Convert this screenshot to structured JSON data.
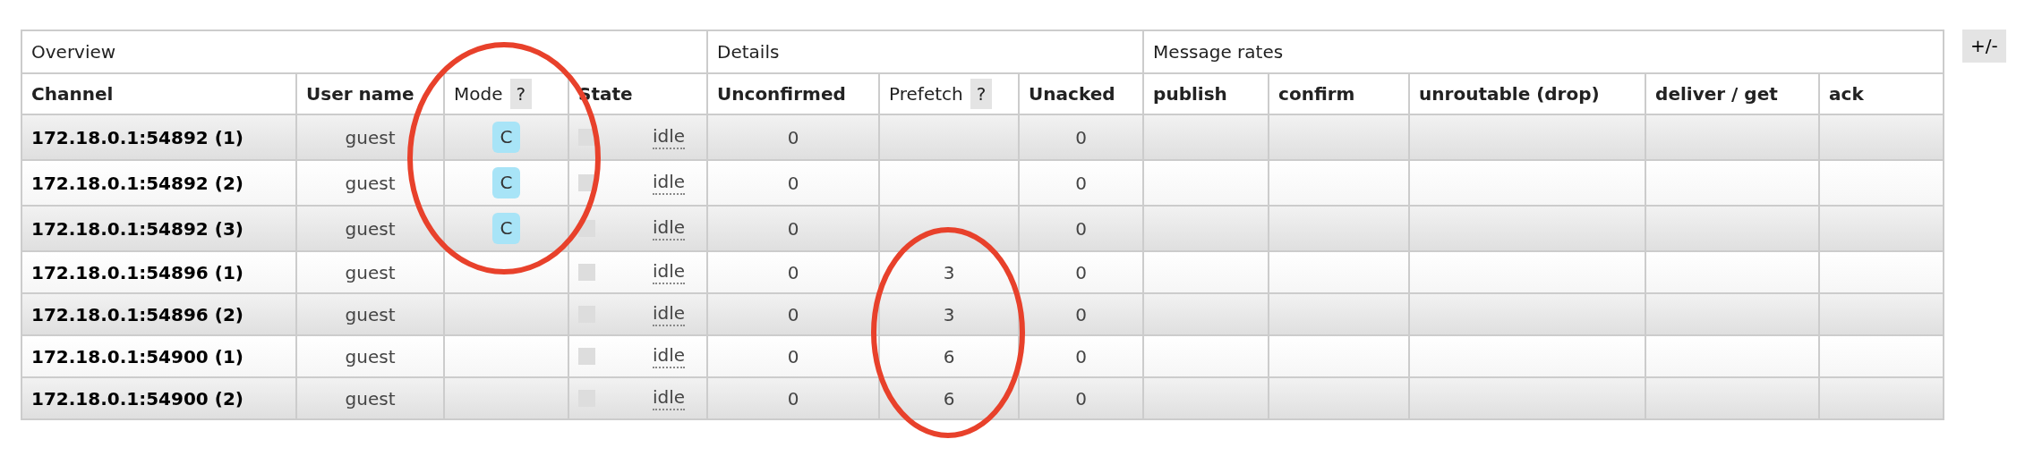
{
  "column_groups": [
    {
      "label": "Overview",
      "columns": [
        {
          "label": "Channel"
        },
        {
          "label": "User name"
        },
        {
          "label": "Mode",
          "help": "?"
        },
        {
          "label": "State"
        }
      ]
    },
    {
      "label": "Details",
      "columns": [
        {
          "label": "Unconfirmed"
        },
        {
          "label": "Prefetch",
          "help": "?"
        },
        {
          "label": "Unacked"
        }
      ]
    },
    {
      "label": "Message rates",
      "columns": [
        {
          "label": "publish"
        },
        {
          "label": "confirm"
        },
        {
          "label": "unroutable (drop)"
        },
        {
          "label": "deliver / get"
        },
        {
          "label": "ack"
        }
      ]
    }
  ],
  "columns_toggle": "+/-",
  "rows": [
    {
      "channel": "172.18.0.1:54892 (1)",
      "user": "guest",
      "mode": "C",
      "state": "idle",
      "unconfirmed": "0",
      "unacked": "0"
    },
    {
      "channel": "172.18.0.1:54892 (2)",
      "user": "guest",
      "mode": "C",
      "state": "idle",
      "unconfirmed": "0",
      "unacked": "0"
    },
    {
      "channel": "172.18.0.1:54892 (3)",
      "user": "guest",
      "mode": "C",
      "state": "idle",
      "unconfirmed": "0",
      "unacked": "0"
    },
    {
      "channel": "172.18.0.1:54896 (1)",
      "user": "guest",
      "state": "idle",
      "unconfirmed": "0",
      "prefetch": "3",
      "unacked": "0"
    },
    {
      "channel": "172.18.0.1:54896 (2)",
      "user": "guest",
      "state": "idle",
      "unconfirmed": "0",
      "prefetch": "3",
      "unacked": "0"
    },
    {
      "channel": "172.18.0.1:54900 (1)",
      "user": "guest",
      "state": "idle",
      "unconfirmed": "0",
      "prefetch": "6",
      "unacked": "0"
    },
    {
      "channel": "172.18.0.1:54900 (2)",
      "user": "guest",
      "state": "idle",
      "unconfirmed": "0",
      "prefetch": "6",
      "unacked": "0"
    }
  ]
}
